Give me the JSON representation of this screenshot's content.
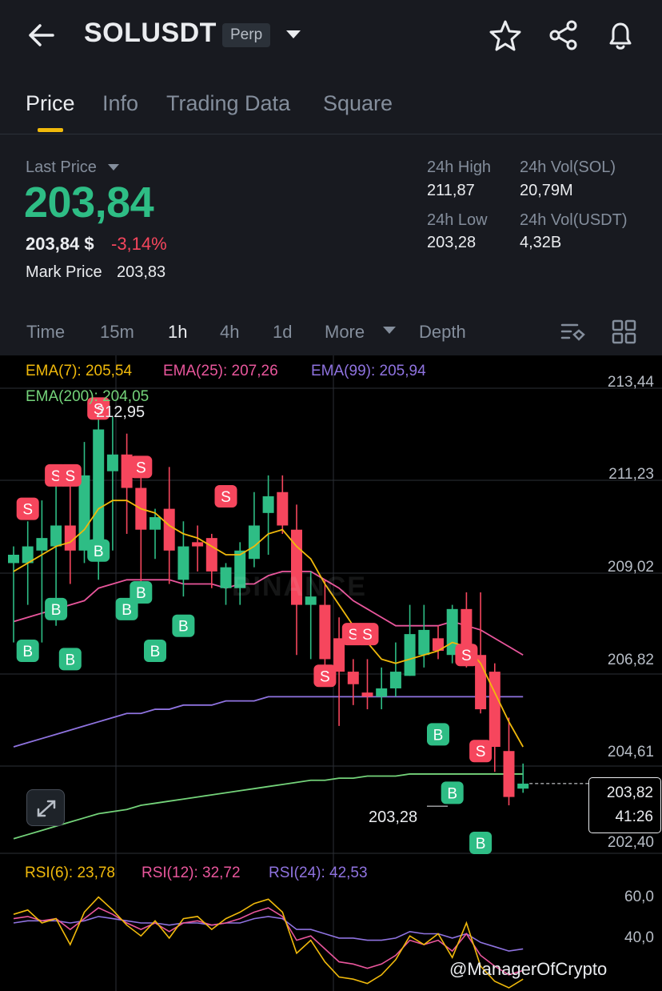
{
  "header": {
    "pair": "SOLUSDT",
    "contract_type": "Perp",
    "icons": [
      "back-arrow-icon",
      "chevron-down-icon",
      "star-icon",
      "share-icon",
      "bell-icon"
    ]
  },
  "tabs": [
    {
      "label": "Price",
      "active": true
    },
    {
      "label": "Info",
      "active": false
    },
    {
      "label": "Trading Data",
      "active": false
    },
    {
      "label": "Square",
      "active": false
    }
  ],
  "ticker": {
    "last_price_label": "Last Price",
    "last_price": "203,84",
    "usd_price": "203,84 $",
    "change_pct": "-3,14%",
    "mark_price_label": "Mark Price",
    "mark_price": "203,83",
    "high_label": "24h High",
    "high": "211,87",
    "low_label": "24h Low",
    "low": "203,28",
    "vol_sol_label": "24h Vol(SOL)",
    "vol_sol": "20,79M",
    "vol_usdt_label": "24h Vol(USDT)",
    "vol_usdt": "4,32B"
  },
  "intervals": [
    {
      "label": "Time",
      "active": false
    },
    {
      "label": "15m",
      "active": false
    },
    {
      "label": "1h",
      "active": true
    },
    {
      "label": "4h",
      "active": false
    },
    {
      "label": "1d",
      "active": false
    },
    {
      "label": "More",
      "active": false
    },
    {
      "label": "Depth",
      "active": false
    }
  ],
  "colors": {
    "up": "#2ebd85",
    "down": "#f6465d",
    "ema7": "#f0b90b",
    "ema25": "#e9569c",
    "ema99": "#8f73e0",
    "ema200": "#74d37a",
    "accent": "#f0b90b"
  },
  "chart_data": {
    "type": "candlestick",
    "interval": "1h",
    "indicators": {
      "ema7": {
        "label": "EMA(7): 205,54",
        "value": 205.54
      },
      "ema25": {
        "label": "EMA(25): 207,26",
        "value": 207.26
      },
      "ema99": {
        "label": "EMA(99): 205,94",
        "value": 205.94
      },
      "ema200": {
        "label": "EMA(200): 204,05",
        "value": 204.05
      }
    },
    "y_ticks": [
      "213,44",
      "211,23",
      "209,02",
      "206,82",
      "204,61",
      "202,40"
    ],
    "y_range": [
      202.4,
      213.44
    ],
    "current_price_label": "203,82",
    "countdown": "41:26",
    "high_marker": "212,95",
    "low_marker": "203,28",
    "watermark": "BINANCE",
    "candles": [
      {
        "o": 209.1,
        "h": 209.5,
        "l": 207.2,
        "c": 209.3
      },
      {
        "o": 209.1,
        "h": 210.1,
        "l": 208.1,
        "c": 209.5
      },
      {
        "o": 209.4,
        "h": 210.6,
        "l": 207.2,
        "c": 209.7
      },
      {
        "o": 209.5,
        "h": 211.0,
        "l": 207.6,
        "c": 210.0
      },
      {
        "o": 210.0,
        "h": 211.2,
        "l": 208.6,
        "c": 209.4
      },
      {
        "o": 209.4,
        "h": 212.0,
        "l": 209.1,
        "c": 211.2
      },
      {
        "o": 209.3,
        "h": 213.0,
        "l": 208.7,
        "c": 212.3
      },
      {
        "o": 211.3,
        "h": 212.6,
        "l": 209.4,
        "c": 211.7
      },
      {
        "o": 211.7,
        "h": 212.2,
        "l": 209.8,
        "c": 210.9
      },
      {
        "o": 210.9,
        "h": 211.3,
        "l": 208.3,
        "c": 209.9
      },
      {
        "o": 209.9,
        "h": 210.4,
        "l": 209.2,
        "c": 210.2
      },
      {
        "o": 210.4,
        "h": 211.4,
        "l": 208.6,
        "c": 209.4
      },
      {
        "o": 208.7,
        "h": 210.1,
        "l": 208.3,
        "c": 209.5
      },
      {
        "o": 209.6,
        "h": 210.0,
        "l": 208.9,
        "c": 209.5
      },
      {
        "o": 209.7,
        "h": 209.8,
        "l": 208.5,
        "c": 208.9
      },
      {
        "o": 208.5,
        "h": 209.1,
        "l": 208.1,
        "c": 209.0
      },
      {
        "o": 208.5,
        "h": 209.6,
        "l": 208.1,
        "c": 209.4
      },
      {
        "o": 209.2,
        "h": 210.8,
        "l": 209.0,
        "c": 210.0
      },
      {
        "o": 210.3,
        "h": 211.2,
        "l": 209.3,
        "c": 210.7
      },
      {
        "o": 210.8,
        "h": 211.2,
        "l": 209.8,
        "c": 210.0
      },
      {
        "o": 209.9,
        "h": 210.5,
        "l": 206.9,
        "c": 208.1
      },
      {
        "o": 208.1,
        "h": 208.9,
        "l": 206.8,
        "c": 208.3
      },
      {
        "o": 208.1,
        "h": 208.7,
        "l": 206.5,
        "c": 206.8
      },
      {
        "o": 207.3,
        "h": 207.8,
        "l": 205.2,
        "c": 206.5
      },
      {
        "o": 206.5,
        "h": 206.8,
        "l": 205.7,
        "c": 206.2
      },
      {
        "o": 206.0,
        "h": 206.8,
        "l": 205.6,
        "c": 205.9
      },
      {
        "o": 205.9,
        "h": 206.6,
        "l": 205.6,
        "c": 206.1
      },
      {
        "o": 206.1,
        "h": 207.2,
        "l": 205.9,
        "c": 206.5
      },
      {
        "o": 206.4,
        "h": 208.1,
        "l": 206.4,
        "c": 207.4
      },
      {
        "o": 206.9,
        "h": 208.1,
        "l": 206.6,
        "c": 207.5
      },
      {
        "o": 207.3,
        "h": 207.6,
        "l": 206.8,
        "c": 207.0
      },
      {
        "o": 206.9,
        "h": 208.1,
        "l": 206.7,
        "c": 208.0
      },
      {
        "o": 208.0,
        "h": 208.4,
        "l": 206.6,
        "c": 206.8
      },
      {
        "o": 206.9,
        "h": 208.4,
        "l": 205.5,
        "c": 205.6
      },
      {
        "o": 206.5,
        "h": 206.7,
        "l": 204.1,
        "c": 204.7
      },
      {
        "o": 204.6,
        "h": 205.4,
        "l": 203.3,
        "c": 203.5
      },
      {
        "o": 203.7,
        "h": 204.3,
        "l": 203.6,
        "c": 203.82
      }
    ],
    "trade_markers": [
      {
        "type": "S",
        "i": 1,
        "y": 210.4
      },
      {
        "type": "S",
        "i": 3,
        "y": 211.2
      },
      {
        "type": "S",
        "i": 4,
        "y": 211.2
      },
      {
        "type": "S",
        "i": 6,
        "y": 212.8
      },
      {
        "type": "S",
        "i": 9,
        "y": 211.4
      },
      {
        "type": "S",
        "i": 15,
        "y": 210.7
      },
      {
        "type": "S",
        "i": 24,
        "y": 207.4
      },
      {
        "type": "S",
        "i": 25,
        "y": 207.4
      },
      {
        "type": "S",
        "i": 22,
        "y": 206.4
      },
      {
        "type": "S",
        "i": 32,
        "y": 206.9
      },
      {
        "type": "S",
        "i": 33,
        "y": 204.6
      },
      {
        "type": "B",
        "i": 1,
        "y": 207.0
      },
      {
        "type": "B",
        "i": 3,
        "y": 208.0
      },
      {
        "type": "B",
        "i": 4,
        "y": 206.8
      },
      {
        "type": "B",
        "i": 6,
        "y": 209.4
      },
      {
        "type": "B",
        "i": 8,
        "y": 208.0
      },
      {
        "type": "B",
        "i": 9,
        "y": 208.4
      },
      {
        "type": "B",
        "i": 10,
        "y": 207.0
      },
      {
        "type": "B",
        "i": 12,
        "y": 207.6
      },
      {
        "type": "B",
        "i": 30,
        "y": 205.0
      },
      {
        "type": "B",
        "i": 31,
        "y": 203.6
      },
      {
        "type": "B",
        "i": 33,
        "y": 202.4
      }
    ],
    "ema7_series": [
      208.9,
      209.1,
      209.3,
      209.5,
      209.6,
      209.9,
      210.4,
      210.6,
      210.6,
      210.4,
      210.3,
      210.0,
      209.8,
      209.7,
      209.5,
      209.3,
      209.3,
      209.5,
      209.8,
      209.9,
      209.5,
      209.2,
      208.6,
      208.1,
      207.6,
      207.2,
      206.8,
      206.7,
      206.8,
      206.9,
      207.0,
      207.2,
      207.1,
      206.7,
      206.0,
      205.3,
      204.7
    ],
    "ema25_series": [
      207.7,
      207.8,
      207.9,
      208.0,
      208.1,
      208.2,
      208.5,
      208.6,
      208.7,
      208.7,
      208.7,
      208.7,
      208.6,
      208.6,
      208.6,
      208.5,
      208.6,
      208.6,
      208.8,
      208.9,
      208.9,
      208.9,
      208.7,
      208.5,
      208.2,
      208.0,
      207.8,
      207.6,
      207.6,
      207.6,
      207.6,
      207.7,
      207.6,
      207.5,
      207.3,
      207.1,
      206.9
    ],
    "ema99_series": [
      204.7,
      204.8,
      204.9,
      205.0,
      205.1,
      205.2,
      205.3,
      205.4,
      205.5,
      205.5,
      205.6,
      205.6,
      205.7,
      205.7,
      205.7,
      205.8,
      205.8,
      205.8,
      205.9,
      205.9,
      205.9,
      205.9,
      205.9,
      205.9,
      205.9,
      205.9,
      205.9,
      205.9,
      205.9,
      205.9,
      205.9,
      205.9,
      205.9,
      205.9,
      205.9,
      205.9,
      205.9
    ],
    "ema200_series": [
      202.5,
      202.6,
      202.7,
      202.8,
      202.9,
      203.0,
      203.1,
      203.15,
      203.2,
      203.3,
      203.35,
      203.4,
      203.45,
      203.5,
      203.55,
      203.6,
      203.65,
      203.7,
      203.75,
      203.8,
      203.85,
      203.9,
      203.9,
      203.95,
      203.95,
      204.0,
      204.0,
      204.0,
      204.05,
      204.05,
      204.05,
      204.05,
      204.05,
      204.05,
      204.05,
      204.05,
      204.05
    ],
    "rsi": {
      "ticks": [
        "60,0",
        "40,0"
      ],
      "range": [
        20,
        70
      ],
      "rsi6_label": "RSI(6): 23,78",
      "rsi12_label": "RSI(12): 32,72",
      "rsi24_label": "RSI(24): 42,53",
      "rsi6": [
        54,
        56,
        50,
        52,
        40,
        55,
        62,
        56,
        49,
        44,
        51,
        43,
        52,
        53,
        47,
        52,
        55,
        59,
        61,
        55,
        36,
        42,
        32,
        25,
        24,
        22,
        26,
        33,
        44,
        40,
        45,
        34,
        50,
        30,
        23,
        20,
        24
      ],
      "rsi12": [
        52,
        53,
        51,
        52,
        47,
        52,
        57,
        54,
        50,
        47,
        50,
        46,
        50,
        51,
        49,
        50,
        52,
        55,
        57,
        53,
        42,
        44,
        38,
        32,
        31,
        29,
        31,
        35,
        42,
        40,
        42,
        37,
        45,
        35,
        30,
        26,
        28
      ],
      "rsi24": [
        50,
        51,
        51,
        51,
        50,
        51,
        53,
        52,
        51,
        50,
        50,
        49,
        50,
        50,
        49,
        50,
        50,
        52,
        53,
        52,
        47,
        47,
        45,
        43,
        43,
        42,
        42,
        43,
        46,
        45,
        45,
        43,
        45,
        41,
        39,
        37,
        38
      ]
    }
  },
  "credit": "@ManagerOfCrypto"
}
